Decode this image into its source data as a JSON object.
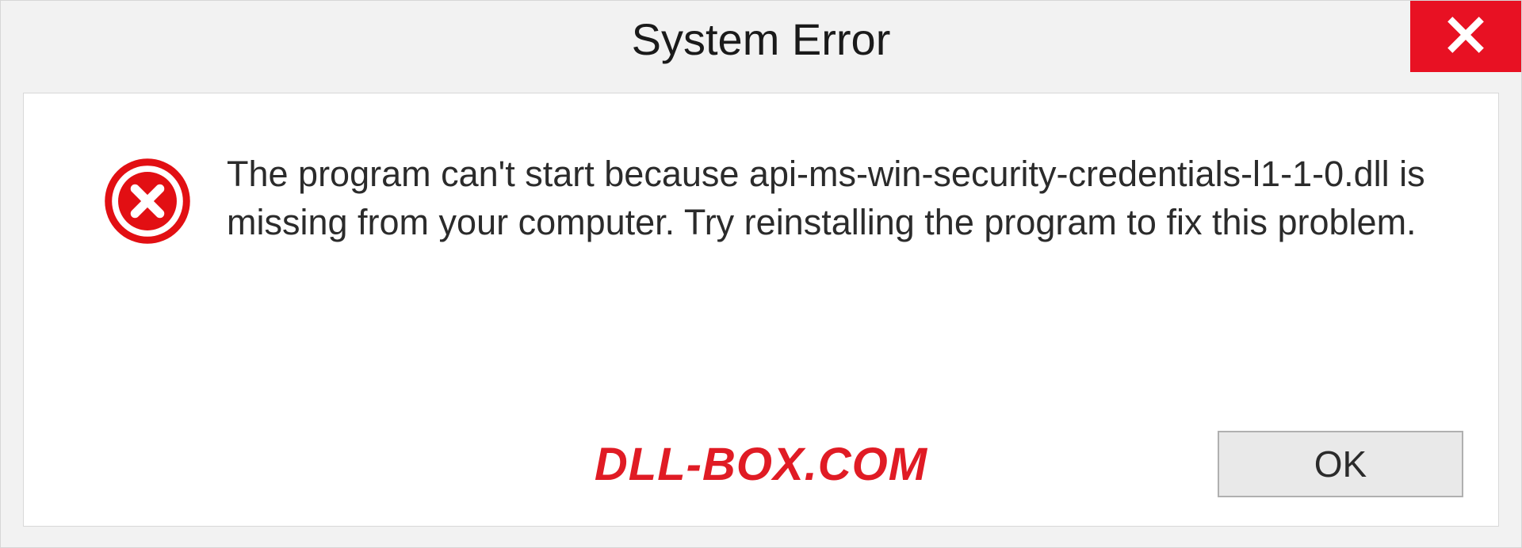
{
  "titlebar": {
    "title": "System Error"
  },
  "dialog": {
    "message": "The program can't start because api-ms-win-security-credentials-l1-1-0.dll is missing from your computer. Try reinstalling the program to fix this problem.",
    "ok_label": "OK"
  },
  "watermark": {
    "text": "DLL-BOX.COM"
  },
  "colors": {
    "close_bg": "#e81123",
    "error_icon": "#e20f13",
    "watermark": "#e01b24"
  }
}
